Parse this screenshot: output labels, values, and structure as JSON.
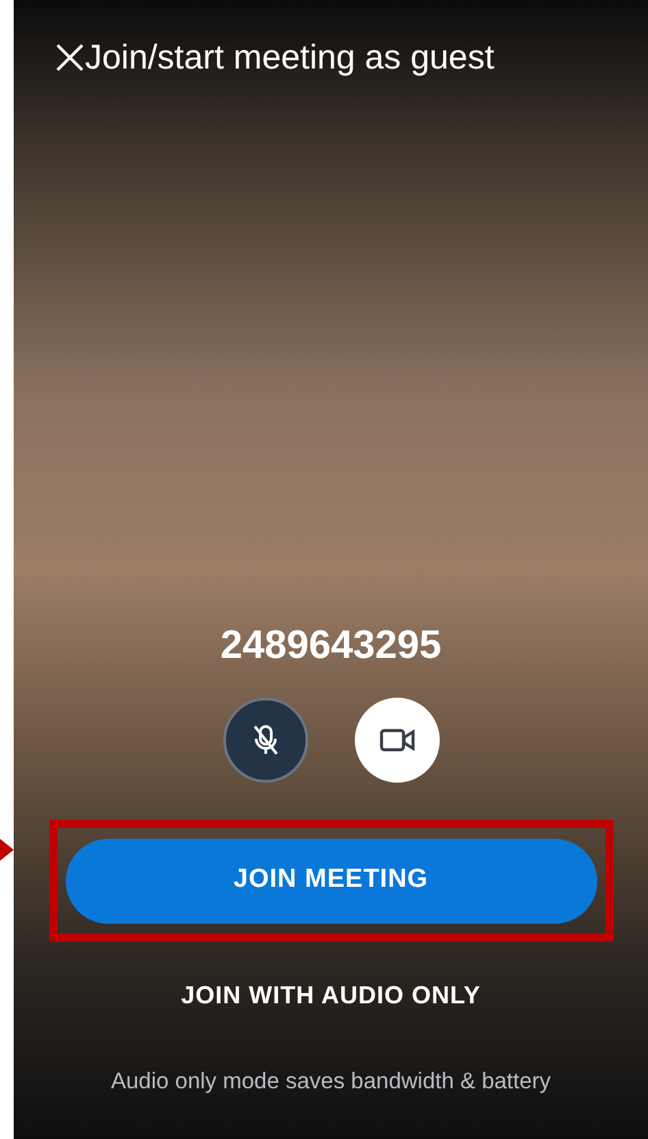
{
  "header": {
    "title": "Join/start meeting as guest"
  },
  "meeting_id": "2489643295",
  "toggles": [
    {
      "kind": "microphone",
      "on": false
    },
    {
      "kind": "camera",
      "on": true
    }
  ],
  "primary_button": {
    "label": "JOIN MEETING",
    "highlighted": true
  },
  "secondary_button": {
    "label": "JOIN WITH AUDIO ONLY"
  },
  "note": "Audio only mode saves bandwidth & battery"
}
